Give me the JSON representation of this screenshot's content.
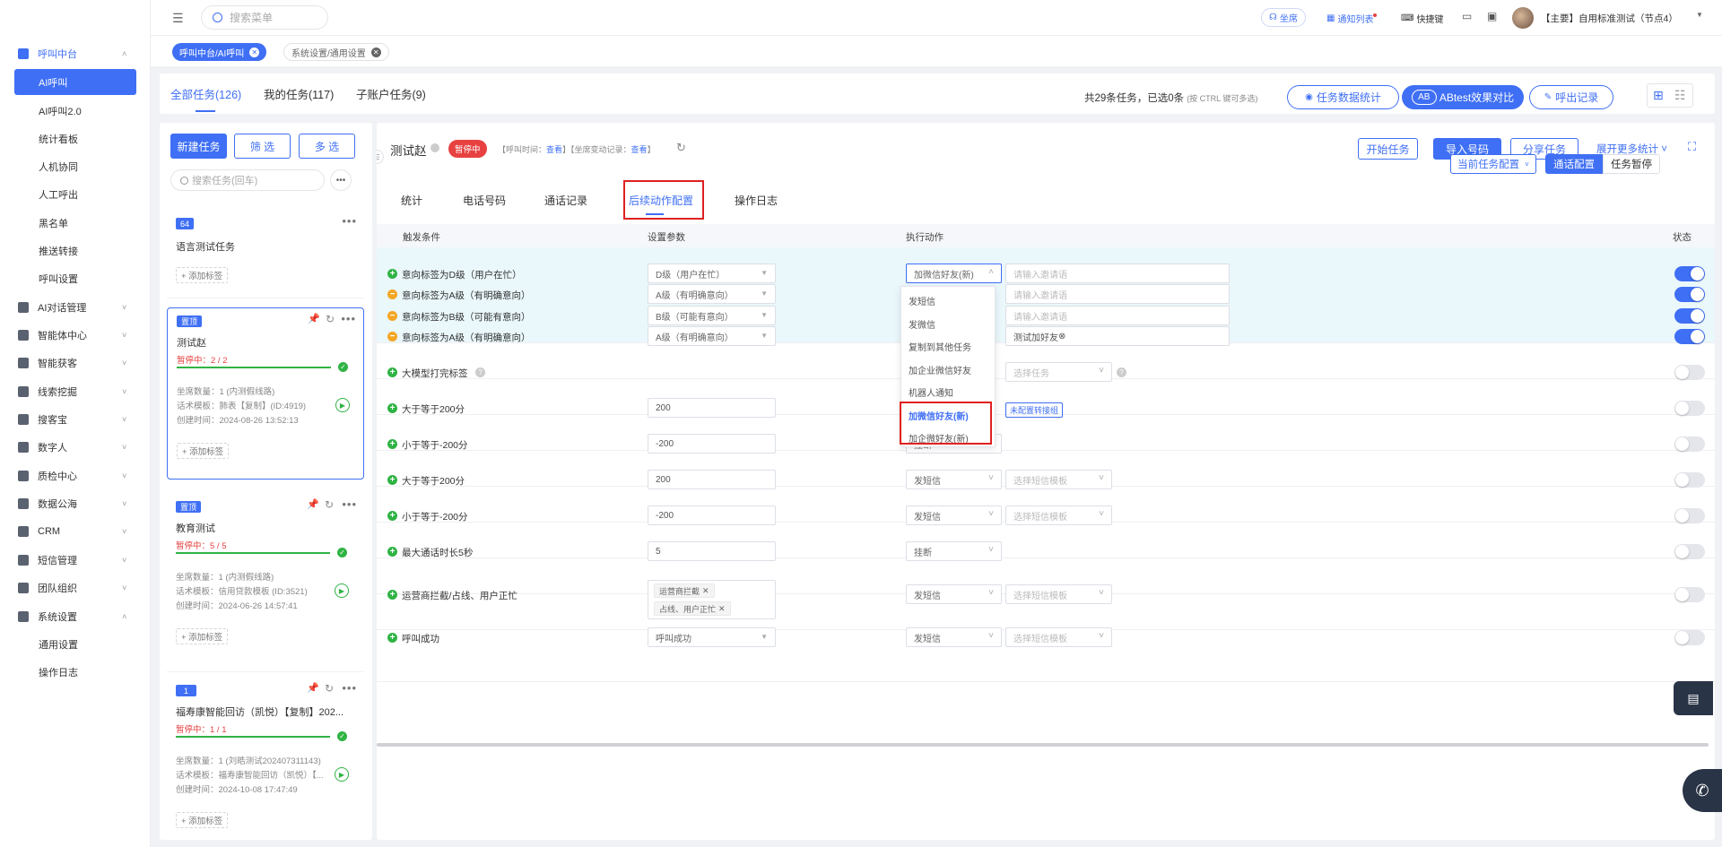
{
  "colors": {
    "primary": "#3f6ff4",
    "success": "#2fb344",
    "danger": "#e84141",
    "warning": "#f5a623",
    "highlight_box": "#e02020"
  },
  "header": {
    "search_placeholder": "搜索菜单",
    "seat": "坐席",
    "notifications": "通知列表",
    "shortcuts": "快捷键",
    "user": "【主要】自用标准测试（节点4）"
  },
  "tags": [
    {
      "label": "呼叫中台/AI呼叫",
      "active": true
    },
    {
      "label": "系统设置/通用设置",
      "active": false
    }
  ],
  "sidebar": {
    "items": [
      {
        "label": "呼叫中台",
        "type": "parent",
        "expanded": true,
        "icon": "monitor-icon"
      },
      {
        "label": "AI呼叫",
        "type": "sub",
        "selected": true
      },
      {
        "label": "AI呼叫2.0",
        "type": "sub"
      },
      {
        "label": "统计看板",
        "type": "sub"
      },
      {
        "label": "人机协同",
        "type": "sub"
      },
      {
        "label": "人工呼出",
        "type": "sub"
      },
      {
        "label": "黑名单",
        "type": "sub"
      },
      {
        "label": "推送转接",
        "type": "sub"
      },
      {
        "label": "呼叫设置",
        "type": "sub"
      },
      {
        "label": "AI对话管理",
        "type": "parent",
        "icon": "chat-icon"
      },
      {
        "label": "智能体中心",
        "type": "parent",
        "icon": "robot-icon"
      },
      {
        "label": "智能获客",
        "type": "parent",
        "icon": "search-icon"
      },
      {
        "label": "线索挖掘",
        "type": "parent",
        "icon": "target-icon"
      },
      {
        "label": "搜客宝",
        "type": "parent",
        "icon": "zoom-icon"
      },
      {
        "label": "数字人",
        "type": "parent",
        "icon": "person-icon"
      },
      {
        "label": "质检中心",
        "type": "parent",
        "icon": "quality-icon"
      },
      {
        "label": "数据公海",
        "type": "parent",
        "icon": "chart-icon"
      },
      {
        "label": "CRM",
        "type": "parent",
        "icon": "crm-icon"
      },
      {
        "label": "短信管理",
        "type": "parent",
        "icon": "sms-icon"
      },
      {
        "label": "团队组织",
        "type": "parent",
        "icon": "team-icon"
      },
      {
        "label": "系统设置",
        "type": "parent",
        "expanded": true,
        "icon": "settings-icon"
      },
      {
        "label": "通用设置",
        "type": "sub"
      },
      {
        "label": "操作日志",
        "type": "sub"
      }
    ]
  },
  "top_tabs": [
    {
      "label": "全部任务(126)",
      "active": true
    },
    {
      "label": "我的任务(117)"
    },
    {
      "label": "子账户任务(9)"
    }
  ],
  "summary": {
    "text": "共29条任务，已选0条",
    "hint": "(按 CTRL 键可多选)"
  },
  "top_buttons": {
    "stats": "任务数据统计",
    "abtest": "ABtest效果对比",
    "call_records": "呼出记录"
  },
  "tasklist": {
    "new_task": "新建任务",
    "filter": "筛 选",
    "multi": "多 选",
    "search_placeholder": "搜索任务(回车)",
    "cards": [
      {
        "badge": "64",
        "title": "语言测试任务",
        "addtag": "+ 添加标签"
      },
      {
        "badge": "置顶",
        "title": "测试赵",
        "status": "暂停中：2 / 2",
        "seats": "坐席数量：1 (内测假线路)",
        "script": "话术模板：肺表【复制】(ID:4919)",
        "created": "创建时间：2024-08-26 13:52:13",
        "addtag": "+ 添加标签"
      },
      {
        "badge": "置顶",
        "title": "教育测试",
        "status": "暂停中：5 / 5",
        "seats": "坐席数量：1 (内测假线路)",
        "script": "话术模板：信用贷款模板 (ID:3521)",
        "created": "创建时间：2024-06-26 14:57:41",
        "addtag": "+ 添加标签"
      },
      {
        "badge": "1",
        "title": "福寿康智能回访（凯悦）【复制】202...",
        "status": "暂停中：1 / 1",
        "seats": "坐席数量：1 (刘皓测试202407311143)",
        "script": "话术模板：福寿康智能回访（凯悦）【...",
        "created": "创建时间：2024-10-08 17:47:49",
        "addtag": "+ 添加标签"
      }
    ]
  },
  "detail": {
    "title": "测试赵",
    "status": "暂停中",
    "call_time_label": "【呼叫时间：",
    "view": "查看",
    "seat_change_label": "】【坐席变动记录：",
    "buttons": {
      "start": "开始任务",
      "import": "导入号码",
      "share": "分享任务",
      "expand": "展开更多统计"
    },
    "tabs": [
      {
        "label": "统计"
      },
      {
        "label": "电话号码"
      },
      {
        "label": "通话记录"
      },
      {
        "label": "后续动作配置",
        "active": true
      },
      {
        "label": "操作日志"
      }
    ],
    "config_buttons": {
      "current": "当前任务配置",
      "call_config": "通话配置",
      "pause": "任务暂停"
    },
    "columns": {
      "trigger": "触发条件",
      "params": "设置参数",
      "action": "执行动作",
      "state": "状态"
    },
    "rows": [
      {
        "icon": "plus",
        "cond": "意向标签为D级（用户在忙）",
        "param": "D级（用户在忙）",
        "action": "加微信好友(新)",
        "extra": "请输入邀请语",
        "extra_ph": true,
        "on": true
      },
      {
        "icon": "minus",
        "cond": "意向标签为A级（有明确意向）",
        "param": "A级（有明确意向）",
        "action": "",
        "extra": "请输入邀请语",
        "extra_ph": true,
        "on": true
      },
      {
        "icon": "minus",
        "cond": "意向标签为B级（可能有意向）",
        "param": "B级（可能有意向）",
        "action": "",
        "extra": "请输入邀请语",
        "extra_ph": true,
        "on": true
      },
      {
        "icon": "minus",
        "cond": "意向标签为A级（有明确意向）",
        "param": "A级（有明确意向）",
        "action": "",
        "extra": "测试加好友",
        "extra_ph": false,
        "on": true
      },
      {
        "icon": "plus",
        "cond": "大模型打完标签",
        "param": "",
        "action": "",
        "extra": "选择任务",
        "extra_ph": true,
        "on": false
      },
      {
        "icon": "plus",
        "cond": "大于等于200分",
        "param": "200",
        "action": "",
        "extra": "未配置转接组",
        "on": false
      },
      {
        "icon": "plus",
        "cond": "小于等于-200分",
        "param": "-200",
        "action": "挂断",
        "on": false
      },
      {
        "icon": "plus",
        "cond": "大于等于200分",
        "param": "200",
        "action": "发短信",
        "extra": "选择短信模板",
        "extra_ph": true,
        "on": false
      },
      {
        "icon": "plus",
        "cond": "小于等于-200分",
        "param": "-200",
        "action": "发短信",
        "extra": "选择短信模板",
        "extra_ph": true,
        "on": false
      },
      {
        "icon": "plus",
        "cond": "最大通话时长5秒",
        "param": "5",
        "action": "挂断",
        "on": false
      },
      {
        "icon": "plus",
        "cond": "运营商拦截/占线、用户正忙",
        "params_tags": [
          "运营商拦截",
          "占线、用户正忙"
        ],
        "action": "发短信",
        "extra": "选择短信模板",
        "extra_ph": true,
        "on": false
      },
      {
        "icon": "plus",
        "cond": "呼叫成功",
        "param": "呼叫成功",
        "action": "发短信",
        "extra": "选择短信模板",
        "extra_ph": true,
        "on": false
      }
    ],
    "dropdown": [
      "发短信",
      "发微信",
      "复制到其他任务",
      "加企业微信好友",
      "机器人通知",
      "加微信好友(新)",
      "加企微好友(新)"
    ],
    "dropdown_selected": "加微信好友(新)"
  }
}
